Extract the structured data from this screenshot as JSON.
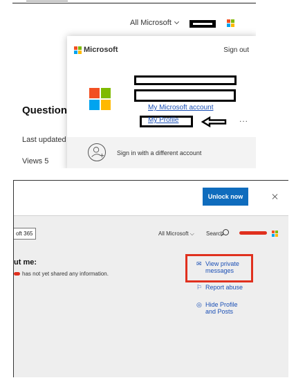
{
  "top_panel": {
    "header": {
      "all_microsoft": "All Microsoft"
    },
    "background": {
      "question_heading": "Question",
      "last_updated": "Last updated",
      "views": "Views 5"
    },
    "account_menu": {
      "brand": "Microsoft",
      "sign_out": "Sign out",
      "my_microsoft_account": "My Microsoft account",
      "my_profile": "My Profile",
      "more": "...",
      "sign_in_different": "Sign in with a different account"
    }
  },
  "bottom_panel": {
    "unlock_button": "Unlock now",
    "microsoft365_tab": "oft 365",
    "all_microsoft": "All Microsoft",
    "search": "Search",
    "about_heading": "ut me:",
    "about_text": "has not yet shared any information.",
    "links": {
      "view_private_messages": "View private messages",
      "report_abuse": "Report abuse",
      "hide_profile": "Hide Profile and Posts"
    }
  },
  "colors": {
    "link_blue": "#1a4fb5",
    "unlock_blue": "#0f6cbd",
    "annotation_red": "#e0301e",
    "ms_red": "#f25022",
    "ms_green": "#7fba00",
    "ms_blue": "#00a4ef",
    "ms_yellow": "#ffb900"
  },
  "icons": [
    "microsoft-logo-icon",
    "chevron-down-icon",
    "person-add-icon",
    "search-icon",
    "close-icon",
    "mail-icon",
    "report-icon",
    "hide-eye-icon",
    "arrow-left-icon"
  ]
}
